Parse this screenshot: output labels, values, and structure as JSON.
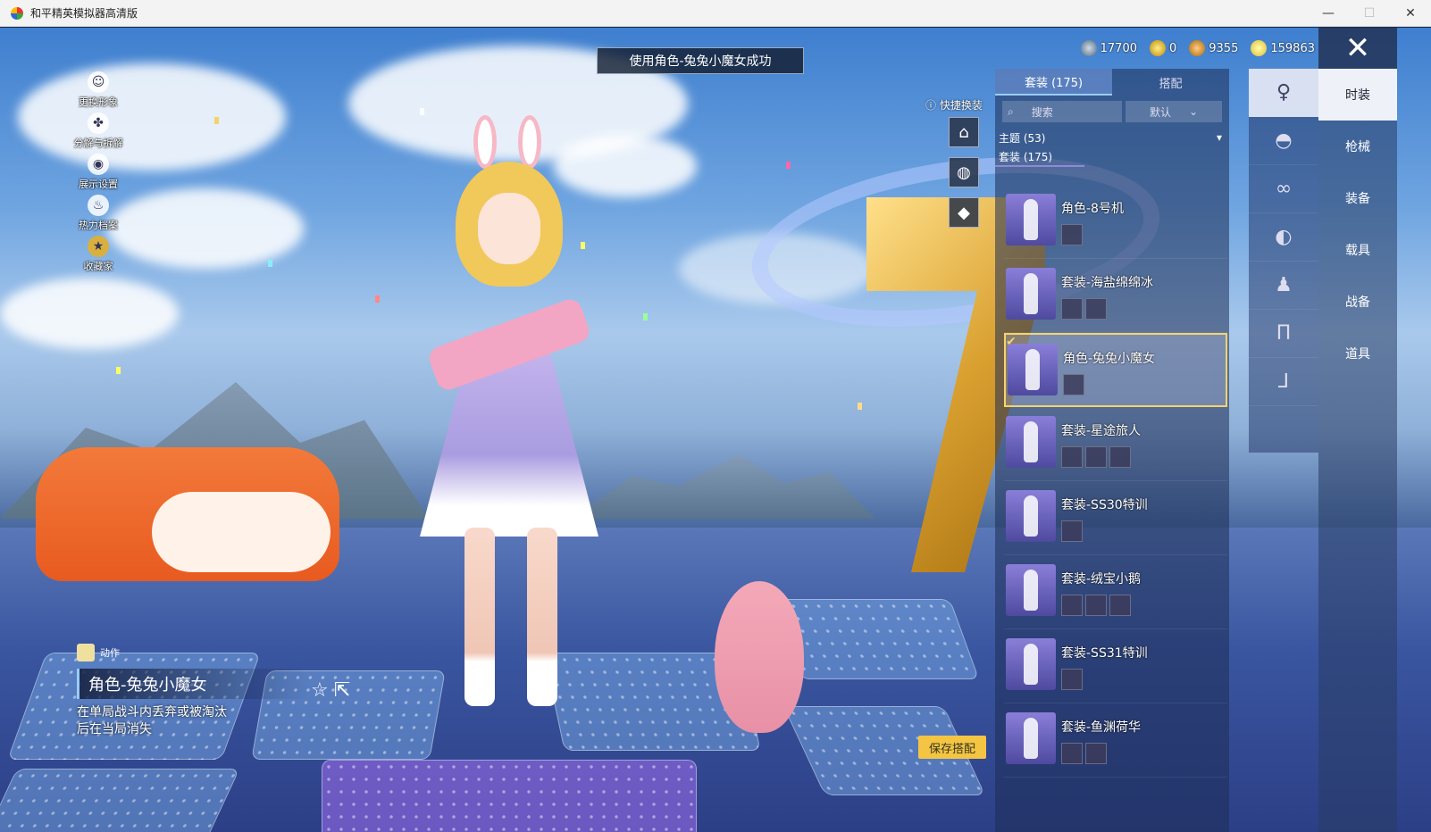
{
  "window": {
    "title": "和平精英模拟器高清版"
  },
  "toast": "使用角色-兔兔小魔女成功",
  "currencies": [
    {
      "icon": "planet-coin-icon",
      "value": "17700",
      "color": "#7a8aa0"
    },
    {
      "icon": "gold-a-coin-icon",
      "value": "0",
      "color": "#d9a520"
    },
    {
      "icon": "bronze-coin-icon",
      "value": "9355",
      "color": "#b87830"
    },
    {
      "icon": "gold-coin-icon",
      "value": "159863",
      "color": "#e8c440"
    }
  ],
  "left_menu": [
    {
      "icon": "avatar-icon",
      "label": "更换形象"
    },
    {
      "icon": "disassemble-icon",
      "label": "分解与拆解"
    },
    {
      "icon": "eye-icon",
      "label": "展示设置"
    },
    {
      "icon": "flame-icon",
      "label": "热力档案"
    },
    {
      "icon": "collector-icon",
      "label": "收藏家"
    }
  ],
  "quick_swap": {
    "label": "快捷换装"
  },
  "list_panel": {
    "tabs": [
      "套装 (175)",
      "搭配"
    ],
    "search_label": "搜索",
    "sort_label": "默认",
    "filter_theme": "主题 (53)",
    "filter_suit": "套装 (175)",
    "items": [
      {
        "name": "角色-8号机",
        "subs": 1,
        "selected": false
      },
      {
        "name": "套装-海盐绵绵冰",
        "subs": 2,
        "selected": false
      },
      {
        "name": "角色-兔兔小魔女",
        "subs": 1,
        "selected": true
      },
      {
        "name": "套装-星途旅人",
        "subs": 3,
        "selected": false
      },
      {
        "name": "套装-SS30特训",
        "subs": 1,
        "selected": false
      },
      {
        "name": "套装-绒宝小鹅",
        "subs": 3,
        "selected": false
      },
      {
        "name": "套装-SS31特训",
        "subs": 1,
        "selected": false
      },
      {
        "name": "套装-鱼渊荷华",
        "subs": 2,
        "selected": false
      }
    ]
  },
  "category_icons": [
    "dress-icon",
    "cap-icon",
    "glasses-icon",
    "mask-icon",
    "outfit-icon",
    "pants-icon",
    "shoes-icon"
  ],
  "right_tabs": [
    "时装",
    "枪械",
    "装备",
    "载具",
    "战备",
    "道具"
  ],
  "action": {
    "tag": "动作",
    "title": "角色-兔兔小魔女",
    "description": "在单局战斗内丢弃或被淘汰后在当局消失"
  },
  "save_button": "保存搭配"
}
